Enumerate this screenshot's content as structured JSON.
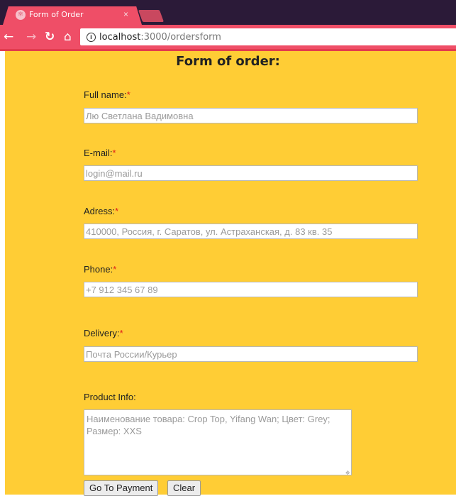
{
  "browser": {
    "tab_title": "Form of Order",
    "tab_close": "×",
    "url_host": "localhost",
    "url_path": ":3000/ordersform",
    "icons": {
      "back": "arrow-left",
      "forward": "arrow-right",
      "reload": "reload",
      "home": "home",
      "info": "info-circle",
      "favicon": "react-logo"
    }
  },
  "form": {
    "title": "Form of order:",
    "required_mark": "*",
    "fields": {
      "full_name": {
        "label": "Full name:",
        "placeholder": "Лю Светлана Вадимовна"
      },
      "email": {
        "label": "E-mail:",
        "placeholder": "login@mail.ru"
      },
      "address": {
        "label": "Adress:",
        "placeholder": "410000, Россия, г. Саратов, ул. Астраханская, д. 83 кв. 35"
      },
      "phone": {
        "label": "Phone:",
        "placeholder": "+7 912 345 67 89"
      },
      "delivery": {
        "label": "Delivery:",
        "placeholder": "Почта России/Курьер"
      },
      "product_info": {
        "label": "Product Info:",
        "placeholder": "Наименование товара: Crop Top, Yifang Wan; Цвет: Grey; Размер: XXS"
      }
    },
    "buttons": {
      "payment": "Go To Payment",
      "clear": "Clear"
    }
  },
  "colors": {
    "page_background": "#ffcd35",
    "browser_accent": "#ef4e67",
    "required": "#e0201a"
  }
}
